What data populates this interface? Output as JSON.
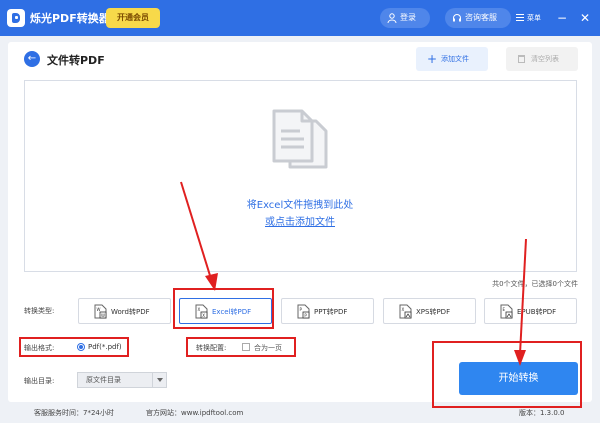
{
  "titlebar": {
    "app_name": "烁光PDF转换器",
    "vip_label": "开通会员",
    "login_label": "登录",
    "support_label": "咨询客服",
    "menu_label": "菜单",
    "minimize_symbol": "−",
    "close_symbol": "✕"
  },
  "header": {
    "title": "文件转PDF",
    "add_file_label": "添加文件",
    "clear_list_label": "清空列表"
  },
  "dropzone": {
    "hint": "将Excel文件拖拽到此处",
    "link": "或点击添加文件"
  },
  "status": {
    "file_count": "共0个文件，已选择0个文件"
  },
  "conversion": {
    "label": "转换类型:",
    "types": [
      {
        "label": "Word转PDF",
        "icon": "word-file-icon",
        "active": false
      },
      {
        "label": "Excel转PDF",
        "icon": "excel-file-icon",
        "active": true
      },
      {
        "label": "PPT转PDF",
        "icon": "ppt-file-icon",
        "active": false
      },
      {
        "label": "XPS转PDF",
        "icon": "xps-file-icon",
        "active": false
      },
      {
        "label": "EPUB转PDF",
        "icon": "epub-file-icon",
        "active": false
      }
    ]
  },
  "output": {
    "format_label": "输出格式:",
    "format_value": "Pdf(*.pdf)",
    "config_label": "转换配置:",
    "config_option": "合为一页",
    "dir_label": "输出目录:",
    "dir_value": "原文件目录"
  },
  "actions": {
    "start_label": "开始转换"
  },
  "footer": {
    "service_hours": "客服服务时间：7*24小时",
    "website": "官方网站：www.ipdftool.com",
    "version": "版本：1.3.0.0"
  },
  "colors": {
    "brand": "#2f6fe4",
    "start_button": "#2f86f0",
    "vip": "#f7d94a",
    "annotation": "#e02020"
  }
}
